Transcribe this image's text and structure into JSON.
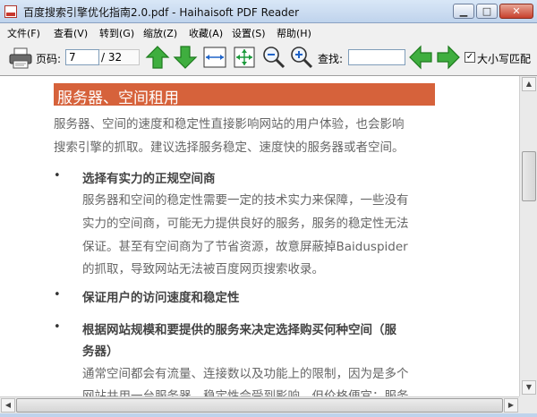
{
  "window": {
    "title": "百度搜索引擎优化指南2.0.pdf - Haihaisoft PDF Reader",
    "min_glyph": "▁",
    "max_glyph": "□",
    "close_glyph": "✕"
  },
  "menu": [
    {
      "label": "文件(F)"
    },
    {
      "label": "查看(V)"
    },
    {
      "label": "转到(G)"
    },
    {
      "label": "缩放(Z)"
    },
    {
      "label": "收藏(A)"
    },
    {
      "label": "设置(S)"
    },
    {
      "label": "帮助(H)"
    }
  ],
  "toolbar": {
    "page_label": "页码:",
    "page_value": "7",
    "total_pages": "/ 32",
    "search_label": "查找:",
    "search_value": "",
    "match_case_label": "大小写匹配",
    "match_case_checked": "✓",
    "icons": [
      "printer-icon",
      "arrow-up-icon",
      "arrow-down-icon",
      "fit-width-icon",
      "fit-page-icon",
      "zoom-out-icon",
      "zoom-in-icon",
      "find-previous-icon",
      "find-next-icon"
    ]
  },
  "document": {
    "heading": "服务器、空间租用",
    "intro": [
      "服务器、空间的速度和稳定性直接影响网站的用户体验，也会影响",
      "搜索引擎的抓取。建议选择服务稳定、速度快的服务器或者空间。"
    ],
    "bullet_glyph": "•",
    "sections": [
      {
        "title": [
          "选择有实力的正规空间商"
        ],
        "body": [
          "服务器和空间的稳定性需要一定的技术实力来保障，一些没有",
          "实力的空间商，可能无力提供良好的服务，服务的稳定性无法",
          "保证。甚至有空间商为了节省资源，故意屏蔽掉Baiduspider",
          "的抓取，导致网站无法被百度网页搜索收录。"
        ]
      },
      {
        "title": [
          "保证用户的访问速度和稳定性"
        ],
        "body": []
      },
      {
        "title": [
          "根据网站规模和要提供的服务来决定选择购买何种空间（服",
          "务器）"
        ],
        "body": [
          "通常空间都会有流量、连接数以及功能上的限制，因为是多个",
          "网站共用一台服务器，稳定性会受到影响，但价格便宜；服务"
        ]
      }
    ]
  },
  "scrollbar": {
    "up": "▲",
    "down": "▼",
    "left": "◀",
    "right": "▶"
  }
}
